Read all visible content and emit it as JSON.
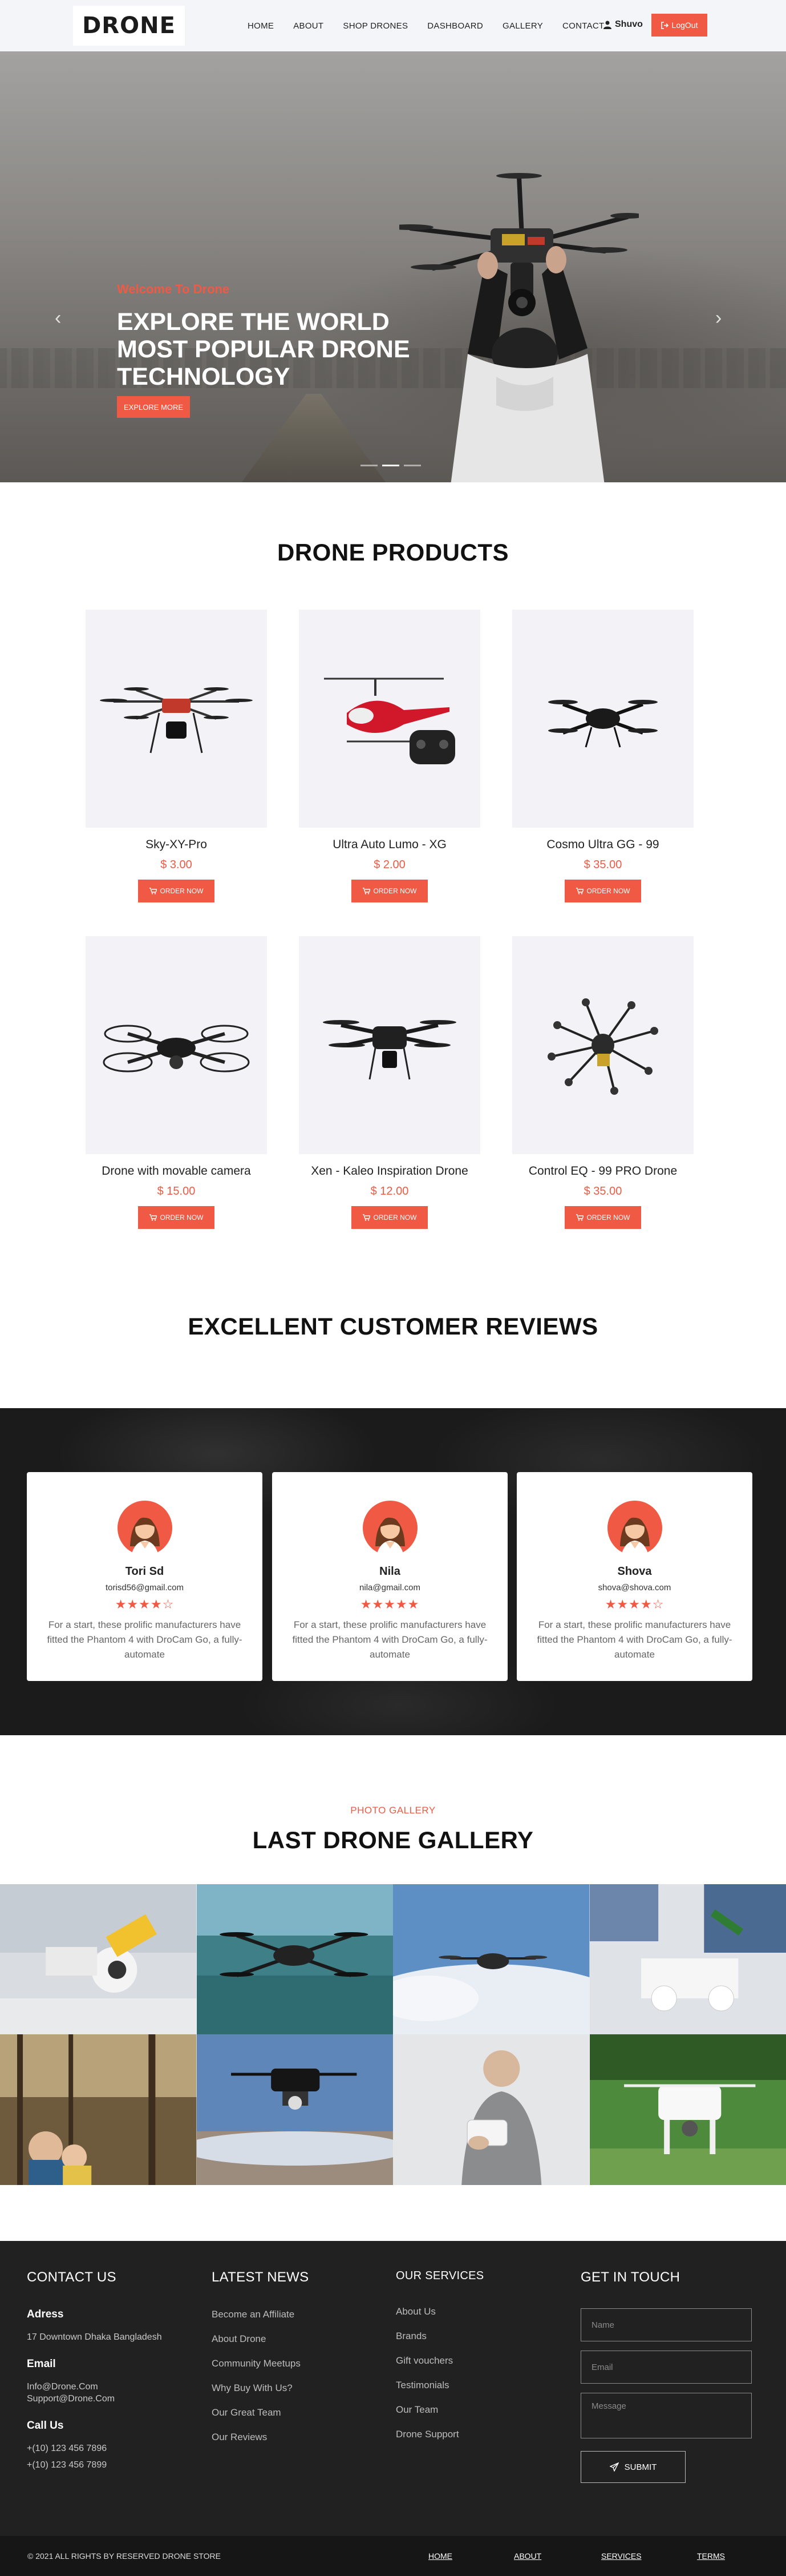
{
  "nav": {
    "logo": "DRONE",
    "menu": [
      "HOME",
      "ABOUT",
      "SHOP DRONES",
      "DASHBOARD",
      "GALLERY",
      "CONTACT"
    ],
    "user_name": "Shuvo",
    "logout_label": "LogOut"
  },
  "hero": {
    "subtitle": "Welcome To Drone",
    "title": "EXPLORE THE WORLD MOST POPULAR DRONE TECHNOLOGY",
    "button": "EXPLORE MORE",
    "prev_icon": "chevron-left-icon",
    "next_icon": "chevron-right-icon"
  },
  "products": {
    "title": "DRONE PRODUCTS",
    "order_label": "ORDER NOW",
    "items": [
      {
        "name": "Sky-XY-Pro",
        "price": "$ 3.00"
      },
      {
        "name": "Ultra Auto Lumo - XG",
        "price": "$ 2.00"
      },
      {
        "name": "Cosmo Ultra GG - 99",
        "price": "$ 35.00"
      },
      {
        "name": "Drone with movable camera",
        "price": "$ 15.00"
      },
      {
        "name": "Xen - Kaleo Inspiration Drone",
        "price": "$ 12.00"
      },
      {
        "name": "Control EQ - 99 PRO Drone",
        "price": "$ 35.00"
      }
    ]
  },
  "reviews": {
    "title": "EXCELLENT CUSTOMER REVIEWS",
    "items": [
      {
        "name": "Tori Sd",
        "email": "torisd56@gmail.com",
        "rating": 4,
        "stars": "★★★★☆",
        "text": "For a start, these prolific manufacturers have fitted the Phantom 4 with DroCam Go, a fully-automate"
      },
      {
        "name": "Nila",
        "email": "nila@gmail.com",
        "rating": 5,
        "stars": "★★★★★",
        "text": "For a start, these prolific manufacturers have fitted the Phantom 4 with DroCam Go, a fully-automate"
      },
      {
        "name": "Shova",
        "email": "shova@shova.com",
        "rating": 4,
        "stars": "★★★★☆",
        "text": "For a start, these prolific manufacturers have fitted the Phantom 4 with DroCam Go, a fully-automate"
      }
    ]
  },
  "gallery": {
    "subtitle": "PHOTO GALLERY",
    "title": "LAST DRONE GALLERY"
  },
  "footer": {
    "contact": {
      "heading": "CONTACT US",
      "address_label": "Adress",
      "address": "17 Downtown Dhaka Bangladesh",
      "email_label": "Email",
      "emails": [
        "Info@Drone.Com",
        "Support@Drone.Com"
      ],
      "call_label": "Call Us",
      "phones": [
        "+(10) 123 456 7896",
        "+(10) 123 456 7899"
      ]
    },
    "news": {
      "heading": "LATEST NEWS",
      "items": [
        "Become an Affiliate",
        "About Drone",
        "Community Meetups",
        "Why Buy With Us?",
        "Our Great Team",
        "Our Reviews"
      ]
    },
    "services": {
      "heading": "OUR SERVICES",
      "items": [
        "About Us",
        "Brands",
        "Gift vouchers",
        "Testimonials",
        "Our Team",
        "Drone Support"
      ]
    },
    "touch": {
      "heading": "GET IN TOUCH",
      "name_placeholder": "Name",
      "email_placeholder": "Email",
      "message_placeholder": "Message",
      "submit": "SUBMIT"
    },
    "copyright": "© 2021 ALL RIGHTS BY RESERVED DRONE STORE",
    "bottom_links": [
      "HOME",
      "ABOUT",
      "SERVICES",
      "TERMS"
    ]
  },
  "colors": {
    "accent": "#f05a45",
    "dark": "#212121",
    "product_bg": "#f2f2f7"
  }
}
